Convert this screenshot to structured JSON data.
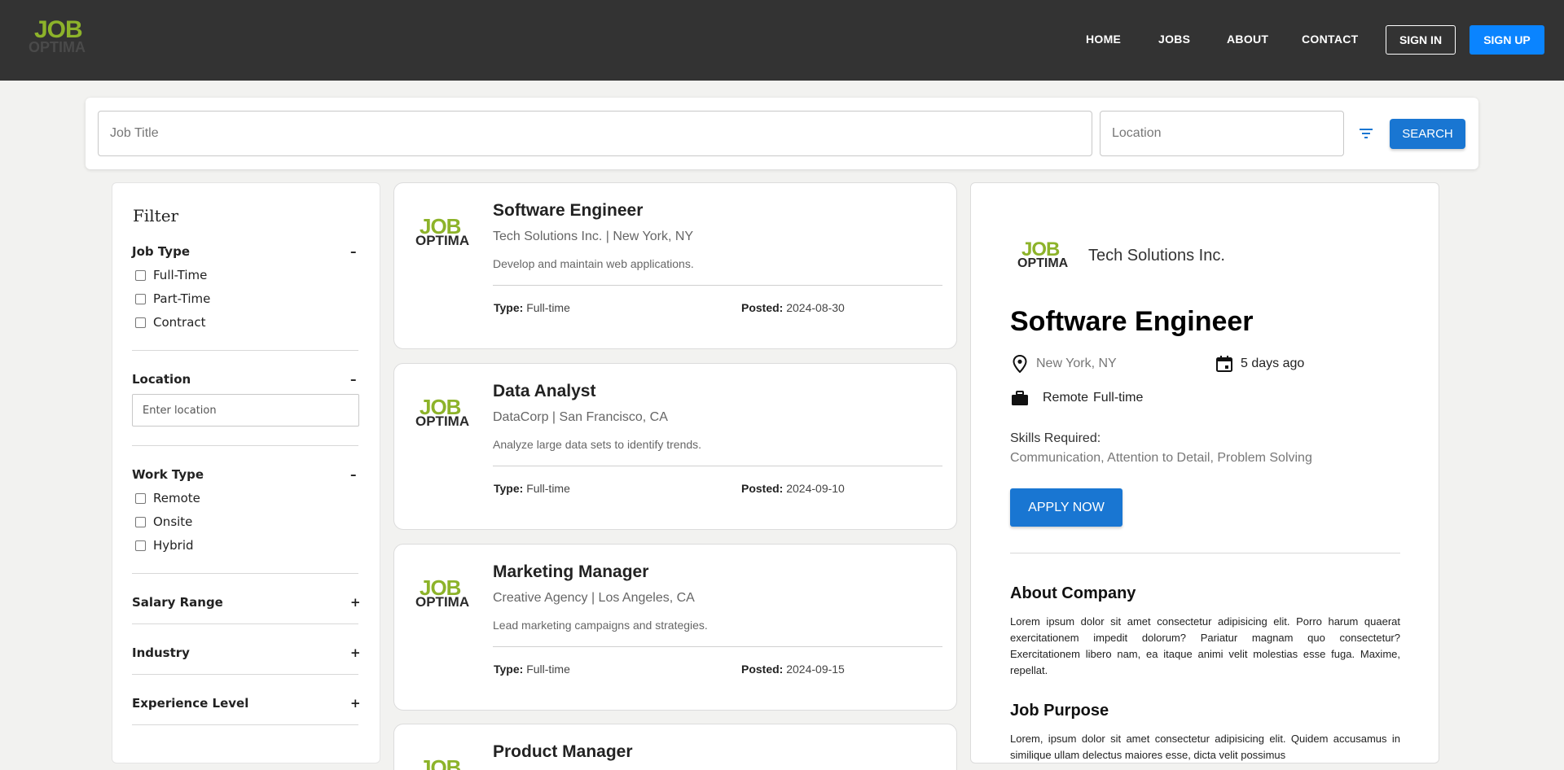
{
  "brand": {
    "logo_top": "JOB",
    "logo_bottom": "OPTIMA",
    "accent": "#8db32a"
  },
  "nav": {
    "links": [
      "HOME",
      "JOBS",
      "ABOUT",
      "CONTACT"
    ],
    "signin_label": "SIGN IN",
    "signup_label": "SIGN UP"
  },
  "search": {
    "title_placeholder": "Job Title",
    "location_placeholder": "Location",
    "filter_icon": "filter-icon",
    "button_label": "SEARCH"
  },
  "filter": {
    "title": "Filter",
    "job_type": {
      "label": "Job Type",
      "toggle": "–",
      "options": [
        "Full-Time",
        "Part-Time",
        "Contract"
      ]
    },
    "location": {
      "label": "Location",
      "toggle": "–",
      "placeholder": "Enter location"
    },
    "work_type": {
      "label": "Work Type",
      "toggle": "–",
      "options": [
        "Remote",
        "Onsite",
        "Hybrid"
      ]
    },
    "salary": {
      "label": "Salary Range",
      "toggle": "+"
    },
    "industry": {
      "label": "Industry",
      "toggle": "+"
    },
    "experience": {
      "label": "Experience Level",
      "toggle": "+"
    }
  },
  "jobs": [
    {
      "title": "Software Engineer",
      "company": "Tech Solutions Inc. | New York, NY",
      "desc": "Develop and maintain web applications.",
      "type_label": "Type:",
      "type": "Full-time",
      "posted_label": "Posted:",
      "posted": "2024-08-30"
    },
    {
      "title": "Data Analyst",
      "company": "DataCorp | San Francisco, CA",
      "desc": "Analyze large data sets to identify trends.",
      "type_label": "Type:",
      "type": "Full-time",
      "posted_label": "Posted:",
      "posted": "2024-09-10"
    },
    {
      "title": "Marketing Manager",
      "company": "Creative Agency | Los Angeles, CA",
      "desc": "Lead marketing campaigns and strategies.",
      "type_label": "Type:",
      "type": "Full-time",
      "posted_label": "Posted:",
      "posted": "2024-09-15"
    },
    {
      "title": "Product Manager"
    }
  ],
  "detail": {
    "company": "Tech Solutions Inc.",
    "title": "Software Engineer",
    "location": "New York, NY",
    "posted": "5 days ago",
    "work_mode": "Remote",
    "employment": "Full-time",
    "skills_label": "Skills Required:",
    "skills": "Communication, Attention to Detail, Problem Solving",
    "apply_label": "APPLY NOW",
    "about_heading": "About Company",
    "about_text": "Lorem ipsum dolor sit amet consectetur adipisicing elit. Porro harum quaerat exercitationem impedit dolorum? Pariatur magnam quo consectetur? Exercitationem libero nam, ea itaque animi velit molestias esse fuga. Maxime, repellat.",
    "purpose_heading": "Job Purpose",
    "purpose_text": "Lorem, ipsum dolor sit amet consectetur adipisicing elit. Quidem accusamus in similique ullam delectus maiores esse, dicta velit possimus"
  }
}
